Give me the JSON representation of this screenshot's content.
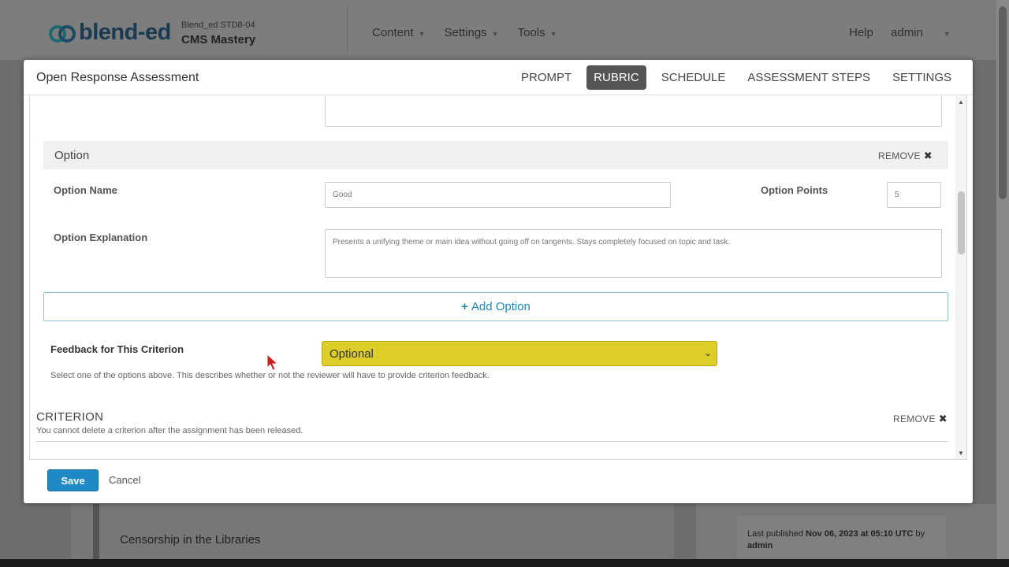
{
  "studio": {
    "logo_text": "blend-ed",
    "course_org": "Blend_ed  STD8-04",
    "course_name": "CMS Mastery",
    "nav": [
      {
        "label": "Content"
      },
      {
        "label": "Settings"
      },
      {
        "label": "Tools"
      }
    ],
    "help_label": "Help",
    "user_label": "admin"
  },
  "background_card": {
    "unit_title": "Censorship in the Libraries",
    "published_prefix": "Last published ",
    "published_date": "Nov 06, 2023 at 05:10 UTC",
    "published_by": " by",
    "published_user": "admin"
  },
  "modal": {
    "title": "Open Response Assessment",
    "tabs": [
      {
        "label": "PROMPT",
        "active": false
      },
      {
        "label": "RUBRIC",
        "active": true
      },
      {
        "label": "SCHEDULE",
        "active": false
      },
      {
        "label": "ASSESSMENT STEPS",
        "active": false
      },
      {
        "label": "SETTINGS",
        "active": false
      }
    ],
    "option": {
      "section_label": "Option",
      "remove_label": "REMOVE",
      "name_label": "Option Name",
      "name_value": "Good",
      "points_label": "Option Points",
      "points_value": "5",
      "explanation_label": "Option Explanation",
      "explanation_value": "Presents a unifying theme or main idea without going off on tangents.  Stays completely focused on topic and task."
    },
    "add_option_label": "Add Option",
    "feedback": {
      "label": "Feedback for This Criterion",
      "selected": "Optional",
      "help": "Select one of the options above. This describes whether or not the reviewer will have to provide criterion feedback."
    },
    "criterion": {
      "title": "CRITERION",
      "remove_label": "REMOVE",
      "note": "You cannot delete a criterion after the assignment has been released."
    },
    "footer": {
      "save_label": "Save",
      "cancel_label": "Cancel"
    }
  },
  "colors": {
    "accent_blue": "#1f89c5",
    "select_highlight": "#dccd29",
    "active_tab": "#555555",
    "cursor": "#cc1b1b"
  }
}
